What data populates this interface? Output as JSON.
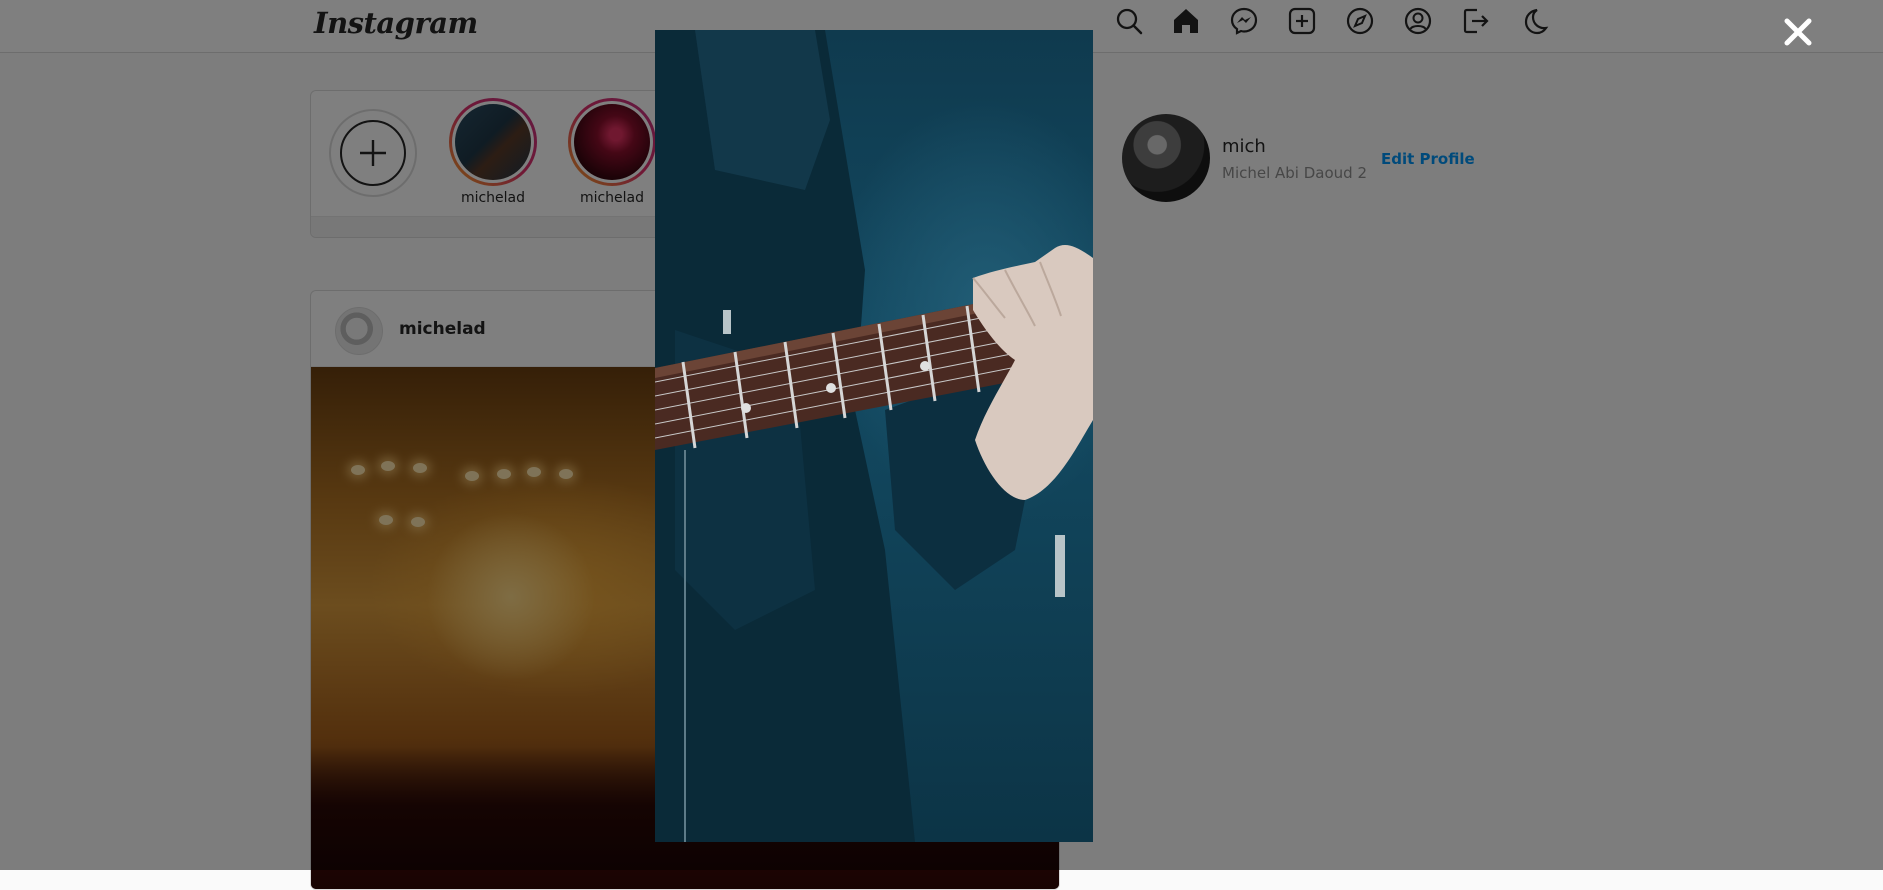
{
  "nav": {
    "logo": "Instagram",
    "icons": [
      "search-icon",
      "home-icon",
      "messenger-icon",
      "new-post-icon",
      "explore-icon",
      "profile-icon",
      "logout-icon",
      "dark-mode-icon"
    ]
  },
  "stories": {
    "items": [
      {
        "name": "michelad"
      },
      {
        "name": "michelad"
      }
    ]
  },
  "post": {
    "username": "michelad"
  },
  "profile": {
    "username": "mich",
    "full_name": "Michel Abi Daoud 2",
    "edit_label": "Edit Profile"
  },
  "modal": {
    "close_icon": "close-icon"
  },
  "colors": {
    "accent": "#0095f6",
    "story_ring_start": "#f9a825",
    "story_ring_end": "#c13584"
  }
}
